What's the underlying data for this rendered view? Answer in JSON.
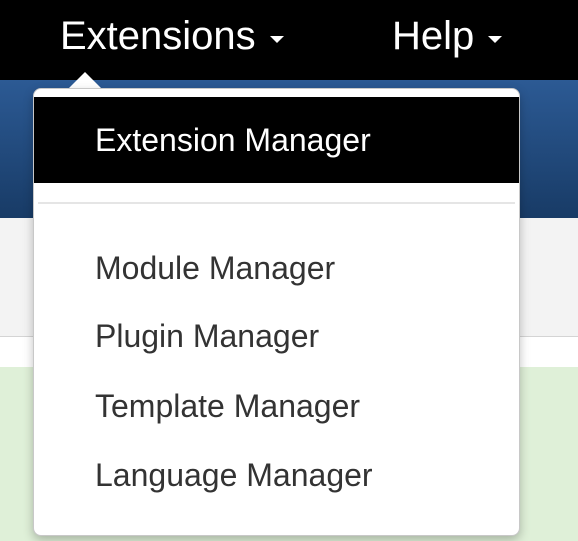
{
  "navbar": {
    "items": [
      {
        "label": "Extensions",
        "icon": "caret-down-icon"
      },
      {
        "label": "Help",
        "icon": "caret-down-icon"
      }
    ]
  },
  "dropdown": {
    "items": [
      {
        "label": "Extension Manager",
        "active": true
      },
      {
        "label": "Module Manager",
        "active": false
      },
      {
        "label": "Plugin Manager",
        "active": false
      },
      {
        "label": "Template Manager",
        "active": false
      },
      {
        "label": "Language Manager",
        "active": false
      }
    ]
  },
  "colors": {
    "navbar": "#000000",
    "header_blue": "#1f4677",
    "active_item_bg": "#000000",
    "active_item_text": "#ffffff",
    "item_text": "#333333",
    "message_green": "#dff0d8"
  }
}
